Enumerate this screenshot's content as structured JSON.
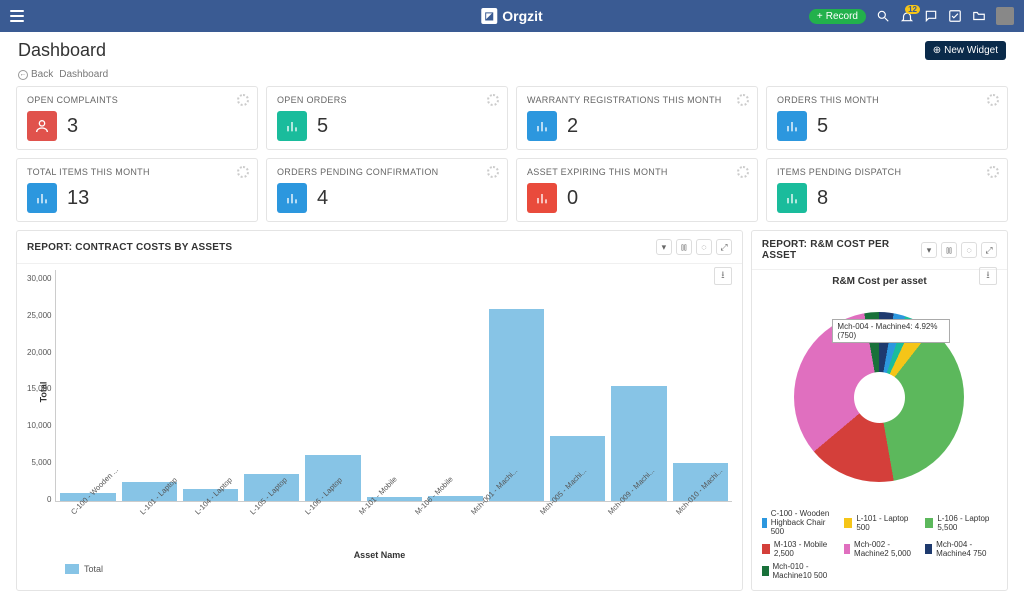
{
  "brand": "Orgzit",
  "header": {
    "record_btn": "Record",
    "bell_count": "12"
  },
  "page": {
    "title": "Dashboard",
    "back": "Back",
    "crumb": "Dashboard",
    "new_widget": "New Widget"
  },
  "metrics": [
    {
      "title": "OPEN COMPLAINTS",
      "value": "3",
      "color": "ic-red",
      "icon": "user"
    },
    {
      "title": "OPEN ORDERS",
      "value": "5",
      "color": "ic-teal",
      "icon": "bar"
    },
    {
      "title": "WARRANTY REGISTRATIONS THIS MONTH",
      "value": "2",
      "color": "ic-blue",
      "icon": "bar"
    },
    {
      "title": "ORDERS THIS MONTH",
      "value": "5",
      "color": "ic-blue",
      "icon": "bar"
    },
    {
      "title": "TOTAL ITEMS THIS MONTH",
      "value": "13",
      "color": "ic-blue",
      "icon": "bar"
    },
    {
      "title": "ORDERS PENDING CONFIRMATION",
      "value": "4",
      "color": "ic-blue",
      "icon": "bar"
    },
    {
      "title": "ASSET EXPIRING THIS MONTH",
      "value": "0",
      "color": "ic-red2",
      "icon": "bar"
    },
    {
      "title": "ITEMS PENDING DISPATCH",
      "value": "8",
      "color": "ic-teal",
      "icon": "bar"
    }
  ],
  "reports": {
    "bar": {
      "title": "REPORT: CONTRACT COSTS BY ASSETS"
    },
    "pie": {
      "title": "REPORT: R&M COST PER ASSET",
      "subtitle": "R&M Cost per asset",
      "tooltip": "Mch-004 - Machine4: 4.92% (750)"
    }
  },
  "chart_data": [
    {
      "type": "bar",
      "title": "REPORT: CONTRACT COSTS BY ASSETS",
      "xlabel": "Asset Name",
      "ylabel": "Total",
      "ylim": [
        0,
        30000
      ],
      "yticks": [
        0,
        5000,
        10000,
        15000,
        20000,
        25000,
        30000
      ],
      "legend": "Total",
      "categories": [
        "C-100 - Wooden ...",
        "L-101 - Laptop",
        "L-104 - Laptop",
        "L-105 - Laptop",
        "L-106 - Laptop",
        "M-101 - Mobile",
        "M-106 - Mobile",
        "Mch-001 - Machi...",
        "Mch-005 - Machi...",
        "Mch-009 - Machi...",
        "Mch-010 - Machi..."
      ],
      "values": [
        1000,
        2500,
        1500,
        3500,
        6000,
        500,
        600,
        25000,
        8500,
        15000,
        5000
      ]
    },
    {
      "type": "pie",
      "title": "R&M Cost per asset",
      "series": [
        {
          "name": "C-100 - Wooden Highback Chair",
          "value": 500,
          "color": "#2c97de"
        },
        {
          "name": "L-101 - Laptop",
          "value": 500,
          "color": "#f5c518"
        },
        {
          "name": "L-106 - Laptop",
          "value": 5500,
          "color": "#5cb85c"
        },
        {
          "name": "M-103 - Mobile",
          "value": 2500,
          "color": "#d43f3a"
        },
        {
          "name": "Mch-002 - Machine2",
          "value": 5000,
          "color": "#e06fbf"
        },
        {
          "name": "Mch-004 - Machine4",
          "value": 750,
          "color": "#1e3a6e"
        },
        {
          "name": "Mch-010 - Machine10",
          "value": 500,
          "color": "#19713a"
        }
      ]
    }
  ]
}
